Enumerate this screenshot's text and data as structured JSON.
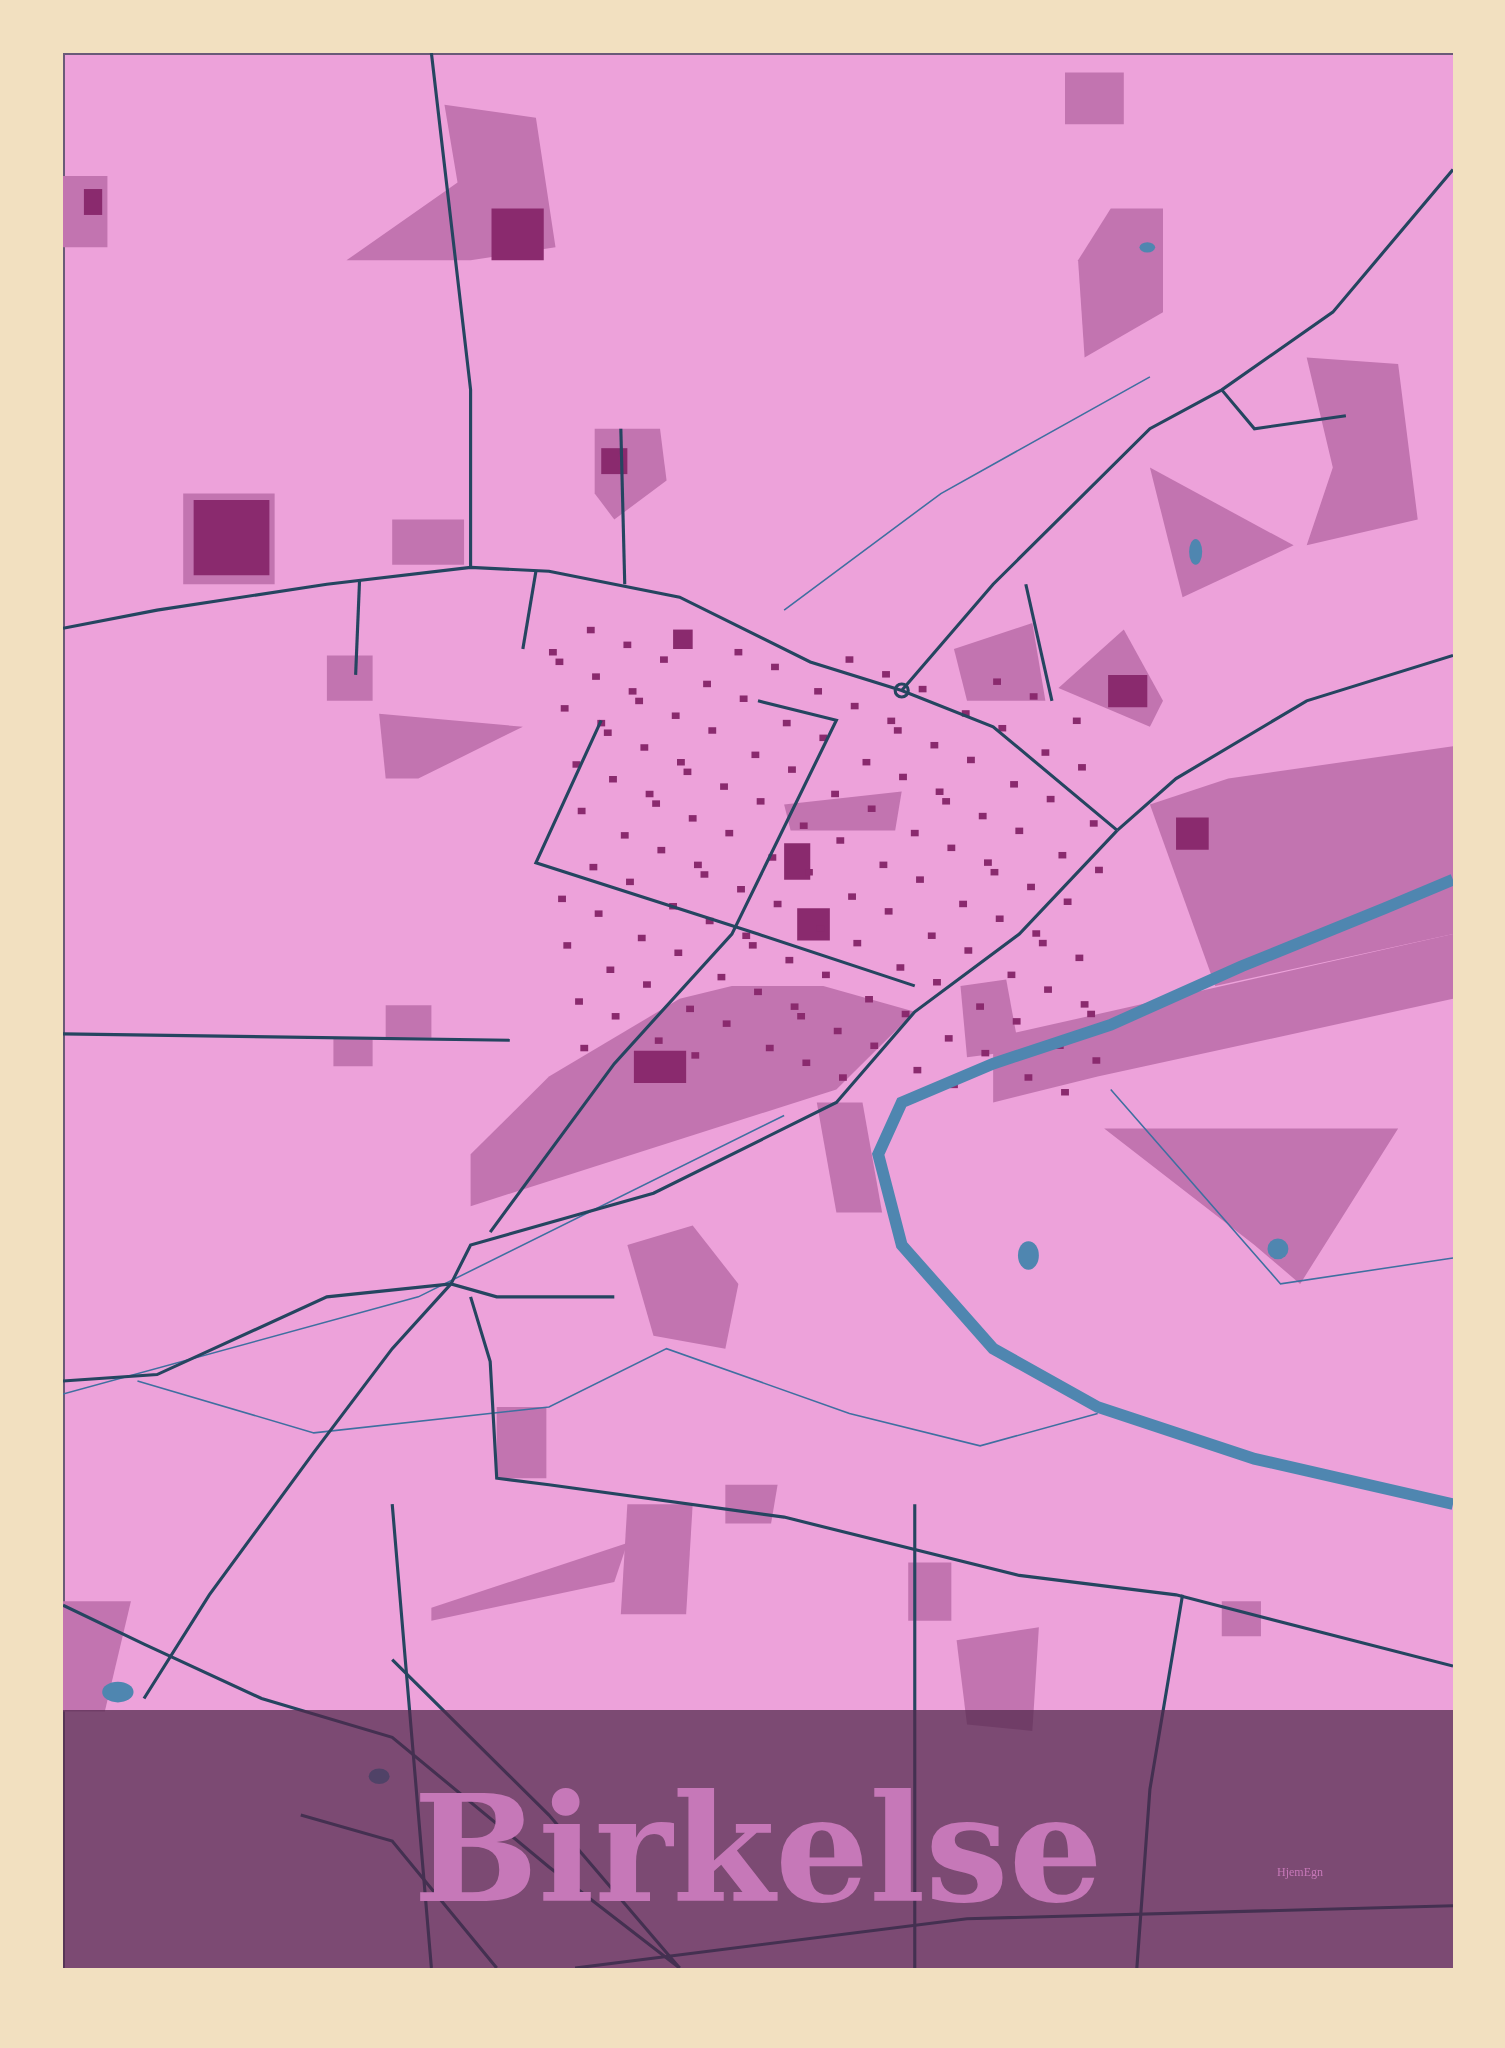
{
  "poster": {
    "title": "Birkelse",
    "logo": "HjemEgn"
  }
}
